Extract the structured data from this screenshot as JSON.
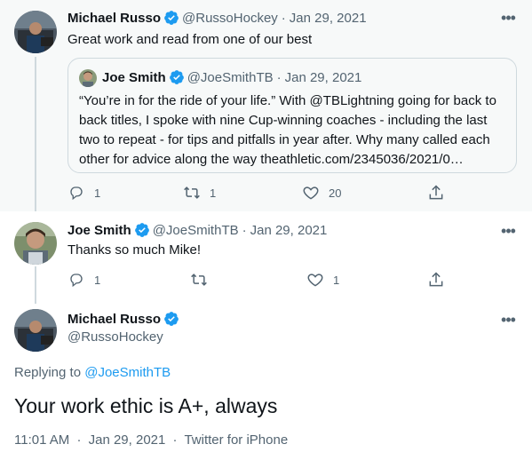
{
  "colors": {
    "accent": "#1d9bf0",
    "text": "#0f1419",
    "muted": "#536471",
    "highlight_bg": "#f7f9f9"
  },
  "tweets": [
    {
      "name": "Michael Russo",
      "handle": "@RussoHockey",
      "dot": "·",
      "date": "Jan 29, 2021",
      "text": "Great work and read from one of our best",
      "quote": {
        "name": "Joe Smith",
        "handle": "@JoeSmithTB",
        "dot": "·",
        "date": "Jan 29, 2021",
        "text": "“You’re in for the ride of your life.” With @TBLightning going for back to back titles, I spoke with nine Cup-winning coaches - including the last two to repeat - for tips and pitfalls in year after. Why many called each other for advice along the way theathletic.com/2345036/2021/0…"
      },
      "replies": "1",
      "retweets": "1",
      "likes": "20"
    },
    {
      "name": "Joe Smith",
      "handle": "@JoeSmithTB",
      "dot": "·",
      "date": "Jan 29, 2021",
      "text": "Thanks so much Mike!",
      "replies": "1",
      "retweets": "",
      "likes": "1"
    }
  ],
  "focus": {
    "name": "Michael Russo",
    "handle": "@RussoHockey",
    "replying_prefix": "Replying to ",
    "replying_to": "@JoeSmithTB",
    "text": "Your work ethic is A+, always",
    "time": "11:01 AM",
    "dot": "·",
    "date": "Jan 29, 2021",
    "source": "Twitter for iPhone"
  },
  "icons": [
    "verified-icon",
    "more-icon",
    "reply-icon",
    "retweet-icon",
    "like-icon",
    "share-icon"
  ]
}
